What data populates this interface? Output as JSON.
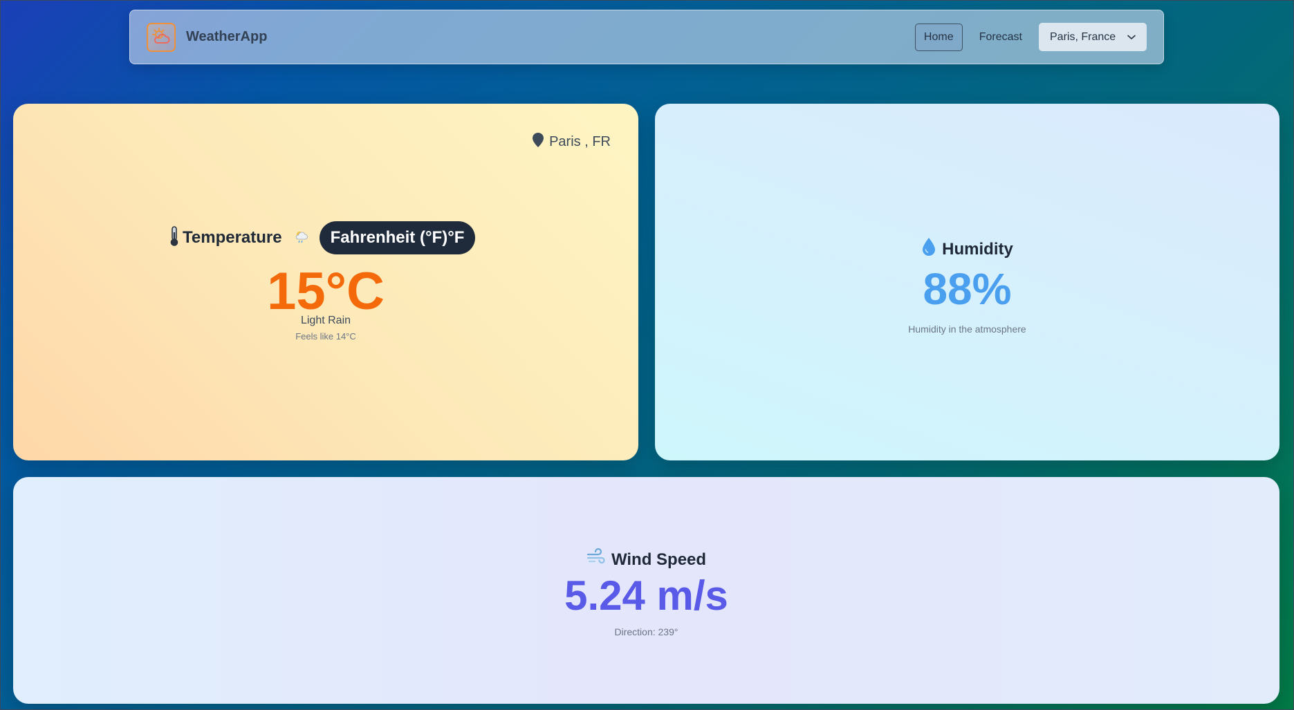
{
  "nav": {
    "brand": "WeatherApp",
    "home_label": "Home",
    "forecast_label": "Forecast",
    "location_select": "Paris, France"
  },
  "temperature": {
    "location": "Paris , FR",
    "title": "Temperature",
    "unit_toggle": "Fahrenheit (°F)°F",
    "value": "15°C",
    "condition": "Light Rain",
    "feels_like": "Feels like 14°C"
  },
  "humidity": {
    "title": "Humidity",
    "value": "88%",
    "caption": "Humidity in the atmosphere"
  },
  "wind": {
    "title": "Wind Speed",
    "value": "5.24 m/s",
    "direction": "Direction: 239°"
  },
  "icons": [
    "weather-logo-icon",
    "location-pin-icon",
    "thermometer-icon",
    "rain-cloud-icon",
    "water-drop-icon",
    "wind-icon",
    "chevron-down-icon"
  ],
  "colors": {
    "temperature_accent": "#f46a0b",
    "humidity_accent": "#4aa0ef",
    "wind_accent": "#5a5ae8",
    "toggle_bg": "#1f2a3b"
  }
}
